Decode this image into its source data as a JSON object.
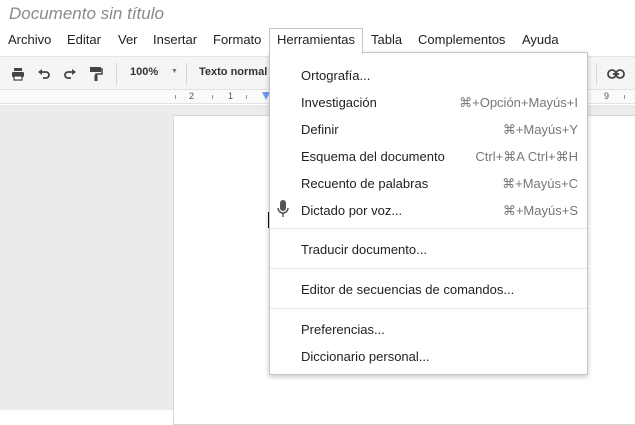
{
  "document": {
    "title": "Documento sin título"
  },
  "menubar": {
    "items": [
      "Archivo",
      "Editar",
      "Ver",
      "Insertar",
      "Formato",
      "Herramientas",
      "Tabla",
      "Complementos",
      "Ayuda"
    ]
  },
  "toolbar": {
    "zoom": "100%",
    "style": "Texto normal",
    "icons": [
      "print-icon",
      "undo-icon",
      "redo-icon",
      "paint-format-icon",
      "link-icon"
    ]
  },
  "ruler": {
    "labels": [
      "2",
      "1",
      "9"
    ]
  },
  "menu": {
    "name": "Herramientas",
    "items": [
      {
        "label": "Ortografía...",
        "shortcut": ""
      },
      {
        "label": "Investigación",
        "shortcut": "⌘+Opción+Mayús+I"
      },
      {
        "label": "Definir",
        "shortcut": "⌘+Mayús+Y"
      },
      {
        "label": "Esquema del documento",
        "shortcut": "Ctrl+⌘A Ctrl+⌘H"
      },
      {
        "label": "Recuento de palabras",
        "shortcut": "⌘+Mayús+C"
      },
      {
        "label": "Dictado por voz...",
        "shortcut": "⌘+Mayús+S",
        "icon": "microphone-icon"
      },
      {
        "label": "Traducir documento..."
      },
      {
        "label": "Editor de secuencias de comandos..."
      },
      {
        "label": "Preferencias..."
      },
      {
        "label": "Diccionario personal..."
      }
    ]
  }
}
